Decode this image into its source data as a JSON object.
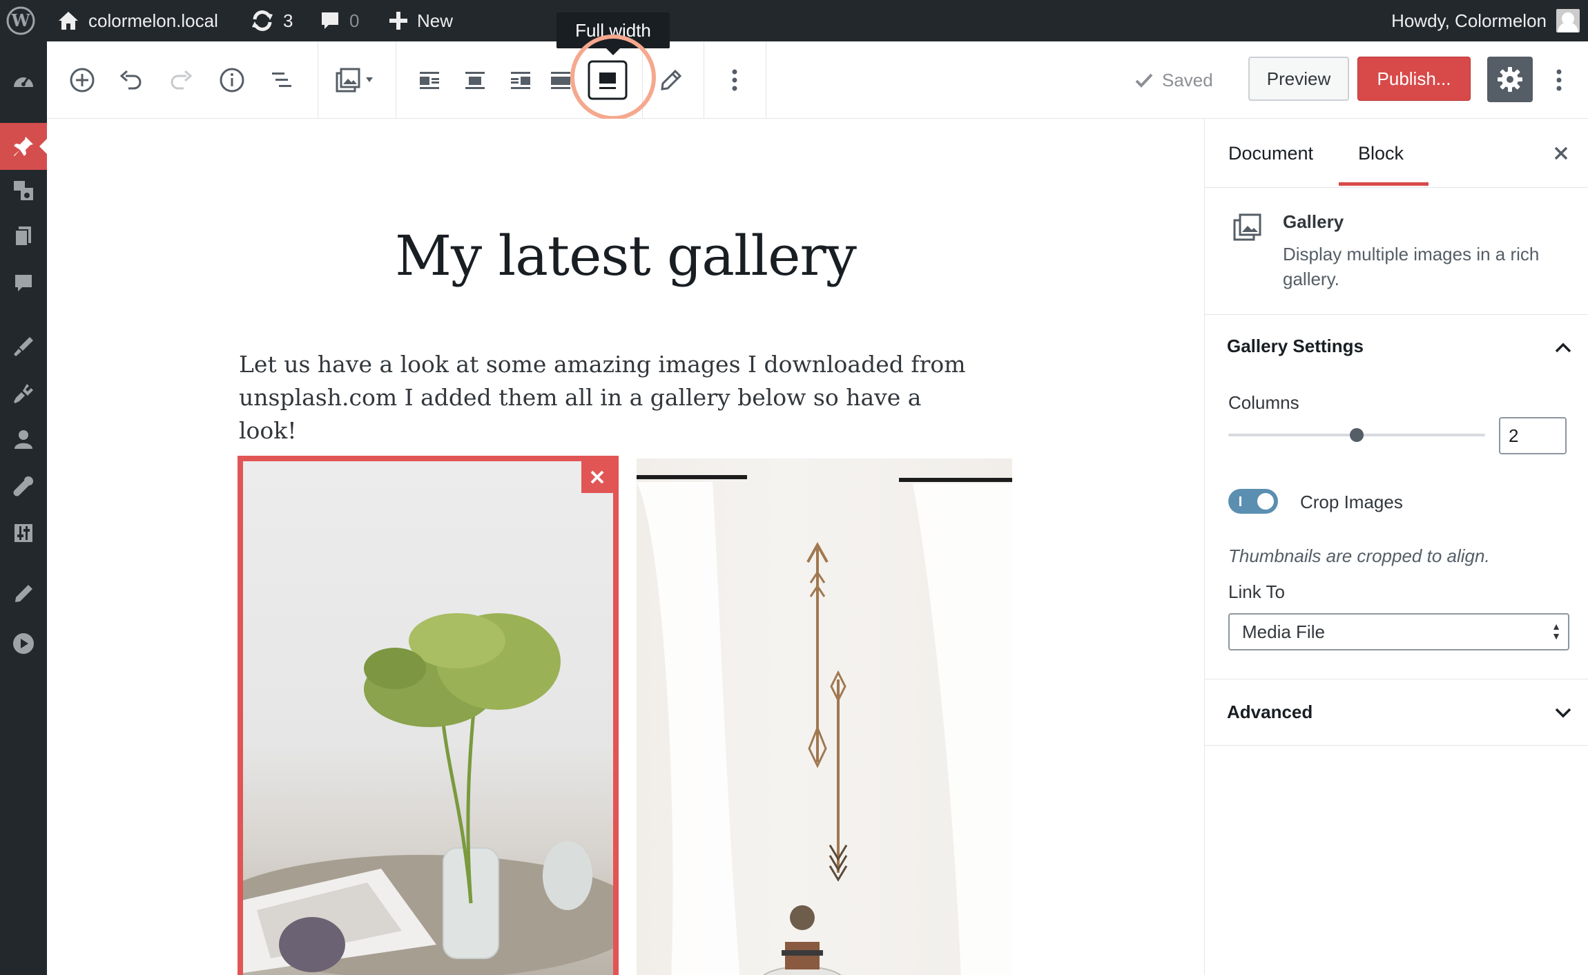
{
  "admin_bar": {
    "site_name": "colormelon.local",
    "updates_count": "3",
    "comments_count": "0",
    "new_label": "New",
    "greeting": "Howdy, Colormelon"
  },
  "toolbar": {
    "tooltip": "Full width",
    "saved_label": "Saved",
    "preview_label": "Preview",
    "publish_label": "Publish..."
  },
  "post": {
    "title": "My latest gallery",
    "paragraph": "Let us have a look at some amazing images I downloaded from unsplash.com I added them all in a gallery below so have a look!"
  },
  "sidebar": {
    "tabs": [
      "Document",
      "Block"
    ],
    "active_tab": "Block",
    "block": {
      "name": "Gallery",
      "description": "Display multiple images in a rich gallery."
    },
    "gallery_settings": {
      "title": "Gallery Settings",
      "columns_label": "Columns",
      "columns_value": "2",
      "columns_slider_fraction": 0.5,
      "crop_label": "Crop Images",
      "crop_enabled": true,
      "crop_help": "Thumbnails are cropped to align.",
      "link_to_label": "Link To",
      "link_to_value": "Media File"
    },
    "advanced_title": "Advanced"
  },
  "colors": {
    "accent_red": "#d84a4a",
    "admin_bar": "#23282d",
    "callout": "#f5a88e",
    "toggle_on": "#5b8fb1"
  },
  "icons": [
    "wordpress-logo-icon",
    "home-icon",
    "updates-icon",
    "comment-icon",
    "plus-icon",
    "add-block-icon",
    "undo-icon",
    "redo-icon",
    "info-icon",
    "outline-icon",
    "gallery-icon",
    "align-left-icon",
    "align-center-icon",
    "align-right-icon",
    "wide-width-icon",
    "full-width-icon",
    "edit-icon",
    "more-icon",
    "check-icon",
    "gear-icon",
    "close-icon",
    "chevron-up-icon",
    "chevron-down-icon"
  ]
}
